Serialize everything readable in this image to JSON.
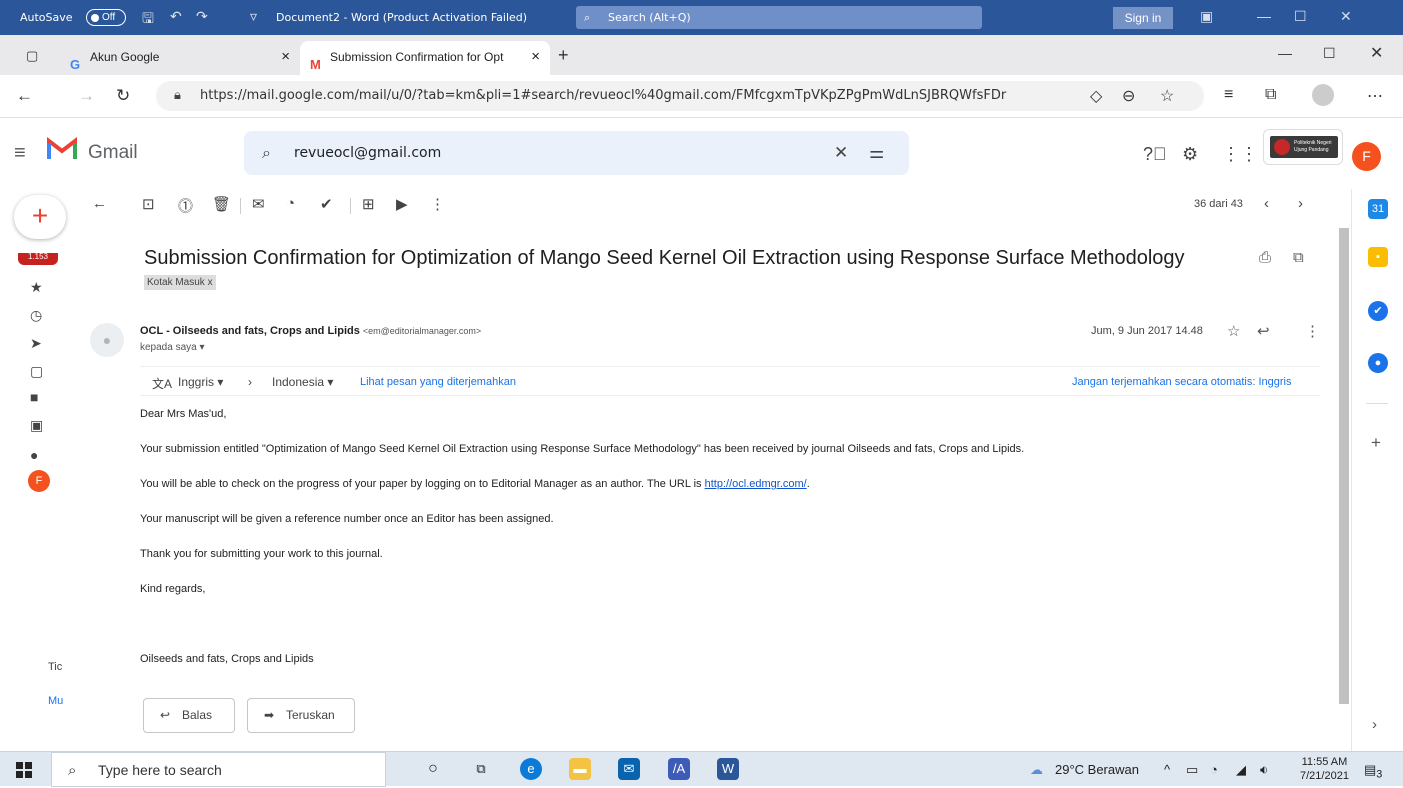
{
  "word": {
    "autosave": "AutoSave",
    "toggle": "Off",
    "title": "Document2  -  Word (Product Activation Failed)",
    "search": "Search (Alt+Q)",
    "signin": "Sign in"
  },
  "browser": {
    "tabs": [
      {
        "label": "Akun Google",
        "favicon": "G"
      },
      {
        "label": "Submission Confirmation for Opt",
        "favicon": "M"
      }
    ],
    "url": "https://mail.google.com/mail/u/0/?tab=km&pli=1#search/revueocl%40gmail.com/FMfcgxmTpVKpZPgPmWdLnSJBRQWfsFDr"
  },
  "gmail": {
    "name": "Gmail",
    "search_value": "revueocl@gmail.com",
    "avatar": "F",
    "brand_text": "Politeknik Negeri Ujung Pandang",
    "inbox_badge": "1.153"
  },
  "rail": {
    "avatar": "F",
    "txt1": "Tic",
    "txt2": "Mu"
  },
  "email": {
    "page_counter": "36 dari 43",
    "subject": "Submission Confirmation for Optimization of Mango Seed Kernel Oil Extraction using Response Surface Methodology",
    "label": "Kotak Masuk",
    "sender_name": "OCL - Oilseeds and fats, Crops and Lipids",
    "sender_email": "<em@editorialmanager.com>",
    "to": "kepada saya",
    "date": "Jum, 9 Jun 2017 14.48",
    "translate": {
      "from": "Inggris",
      "to": "Indonesia",
      "show": "Lihat pesan yang diterjemahkan",
      "never": "Jangan terjemahkan secara otomatis: Inggris"
    },
    "greeting": "Dear Mrs Mas'ud,",
    "p1": "Your submission entitled \"Optimization of Mango Seed Kernel Oil Extraction using Response Surface Methodology\" has been received by journal Oilseeds and fats, Crops and Lipids.",
    "p2": "You will be able to check on the progress of your paper by logging on to Editorial Manager as an author.  The URL is",
    "p2_link": "http://ocl.edmgr.com/",
    "p3": "Your manuscript will be given a reference number once an Editor has been assigned.",
    "p4": "Thank you for submitting your work to this journal.",
    "p5": "Kind regards,",
    "p6": "Oilseeds and fats, Crops and Lipids",
    "reply": "Balas",
    "forward": "Teruskan"
  },
  "taskbar": {
    "search": "Type here to search",
    "weather": "29°C  Berawan",
    "time": "11:55 AM",
    "date": "7/21/2021",
    "notif": "3"
  },
  "colors": {
    "word_blue": "#2b579a",
    "gmail_red": "#ea4335",
    "link": "#1155cc"
  }
}
